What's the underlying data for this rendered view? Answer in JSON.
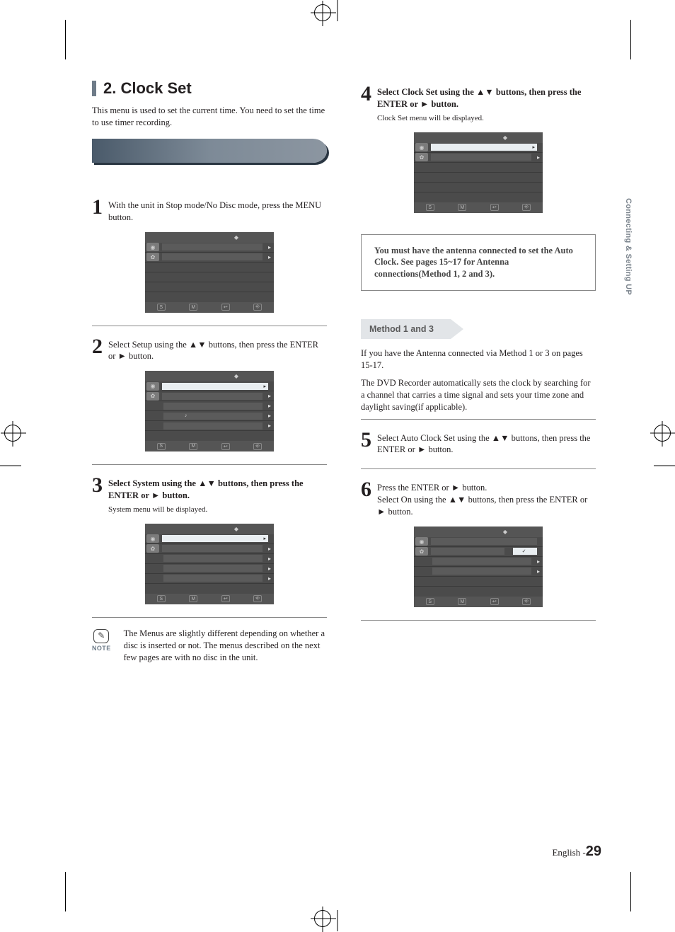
{
  "sidetab": "Connecting & Setting UP",
  "heading": {
    "num": "2.",
    "title": "Clock Set"
  },
  "intro": "This menu is used to set the current time. You need to set the time to use timer recording.",
  "steps": {
    "s1": {
      "text": "With the unit in Stop mode/No Disc mode, press the MENU button."
    },
    "s2": {
      "text_a": "Select Setup using the ",
      "text_b": " buttons, then press the ENTER or ",
      "text_c": " button."
    },
    "s3": {
      "text_a": "Select System using the ",
      "text_b": " buttons, then press the ENTER or ",
      "text_c": " button.",
      "sub": "System menu will be displayed."
    },
    "s4": {
      "text_a": "Select Clock Set using the ",
      "text_b": " buttons, then press the ENTER or ",
      "text_c": " button.",
      "sub": "Clock Set menu will be displayed."
    },
    "s5": {
      "text_a": "Select Auto Clock Set using the ",
      "text_b": " buttons, then press the ENTER or ",
      "text_c": " button."
    },
    "s6": {
      "text_a": "Press the ENTER or ",
      "text_b": " button.",
      "text_c": "Select On using the ",
      "text_d": " buttons, then press the ENTER or ",
      "text_e": " button."
    }
  },
  "note": {
    "label": "NOTE",
    "text": "The Menus are slightly different depending on whether a disc is inserted or not. The menus described on the next few pages are with no disc in the unit."
  },
  "callout": "You must have the antenna connected to set the Auto Clock. See pages 15~17 for Antenna connections(Method 1, 2 and 3).",
  "method_tag": "Method 1 and 3",
  "para1": "If you have the Antenna connected via Method 1 or 3 on pages 15-17.",
  "para2": "The DVD Recorder automatically sets the clock by searching for a channel that carries a time signal and sets your time zone and daylight saving(if applicable).",
  "footer": {
    "lang": "English -",
    "page": "29"
  },
  "symbols": {
    "updown": "▲▼",
    "play": "►"
  },
  "menu_icons": {
    "disc": "◉",
    "gear": "✿",
    "btn_s": "S",
    "btn_m": "M",
    "btn_r": "↩",
    "btn_e": "⎆",
    "note": "♪"
  }
}
